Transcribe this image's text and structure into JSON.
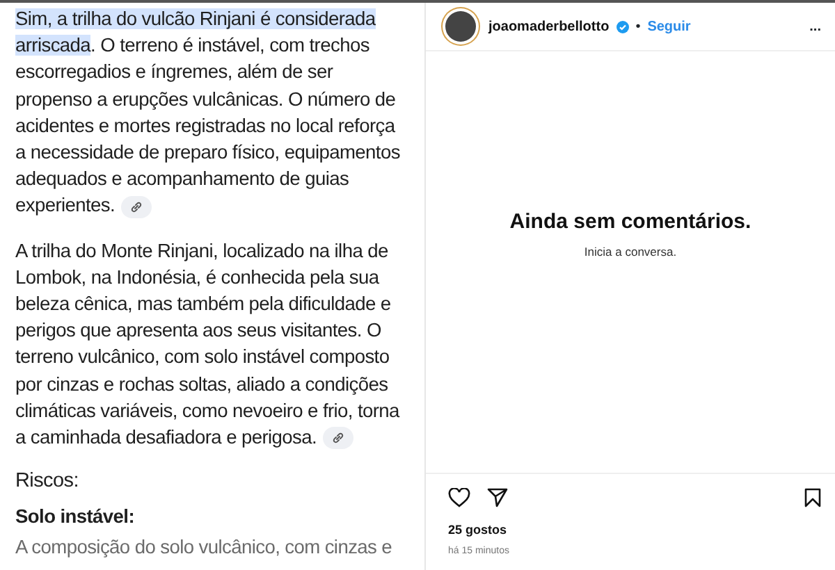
{
  "answer": {
    "paragraphs": [
      {
        "highlight": "Sim, a trilha do vulcão Rinjani é considerada arriscada",
        "text": ". O terreno é instável, com trechos escorregadios e íngremes, além de ser propenso a erupções vulcânicas. O número de acidentes e mortes registradas no local reforça a necessidade de preparo físico, equipamentos adequados e acompanhamento de guias experientes.",
        "source_link": true
      },
      {
        "text": "A trilha do Monte Rinjani, localizado na ilha de Lombok, na Indonésia, é conhecida pela sua beleza cênica, mas também pela dificuldade e perigos que apresenta aos seus visitantes. O terreno vulcânico, com solo instável composto por cinzas e rochas soltas, aliado a condições climáticas variáveis, como nevoeiro e frio, torna a caminhada desafiadora e perigosa.",
        "source_link": true
      }
    ],
    "section_heading": "Riscos:",
    "subheading": "Solo instável:",
    "cut_line": "A composição do solo vulcânico, com cinzas e"
  },
  "post": {
    "username": "joaomaderbellotto",
    "verified": true,
    "separator": "•",
    "follow": "Seguir",
    "more": "...",
    "empty_title": "Ainda sem comentários.",
    "empty_subtitle": "Inicia a conversa.",
    "likes": "25 gostos",
    "time": "há 15 minutos"
  }
}
